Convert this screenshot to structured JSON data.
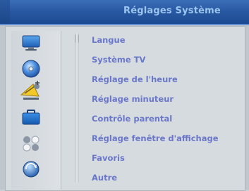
{
  "header": {
    "title": "Réglages Système"
  },
  "menu": {
    "items": [
      {
        "label": "Langue"
      },
      {
        "label": "Système TV"
      },
      {
        "label": "Réglage de l'heure"
      },
      {
        "label": "Réglage minuteur"
      },
      {
        "label": "Contrôle parental"
      },
      {
        "label": "Réglage fenêtre d'affichage"
      },
      {
        "label": "Favoris"
      },
      {
        "label": "Autre"
      }
    ]
  },
  "icons": [
    {
      "name": "monitor-icon"
    },
    {
      "name": "disc-icon"
    },
    {
      "name": "satellite-dish-icon"
    },
    {
      "name": "briefcase-icon"
    },
    {
      "name": "dots-cluster-icon"
    },
    {
      "name": "refresh-globe-icon"
    }
  ],
  "colors": {
    "title_bar": "#2a59a3",
    "title_text": "#9cc6f0",
    "menu_text": "#6a77c9",
    "panel": "#d6dbe0"
  }
}
